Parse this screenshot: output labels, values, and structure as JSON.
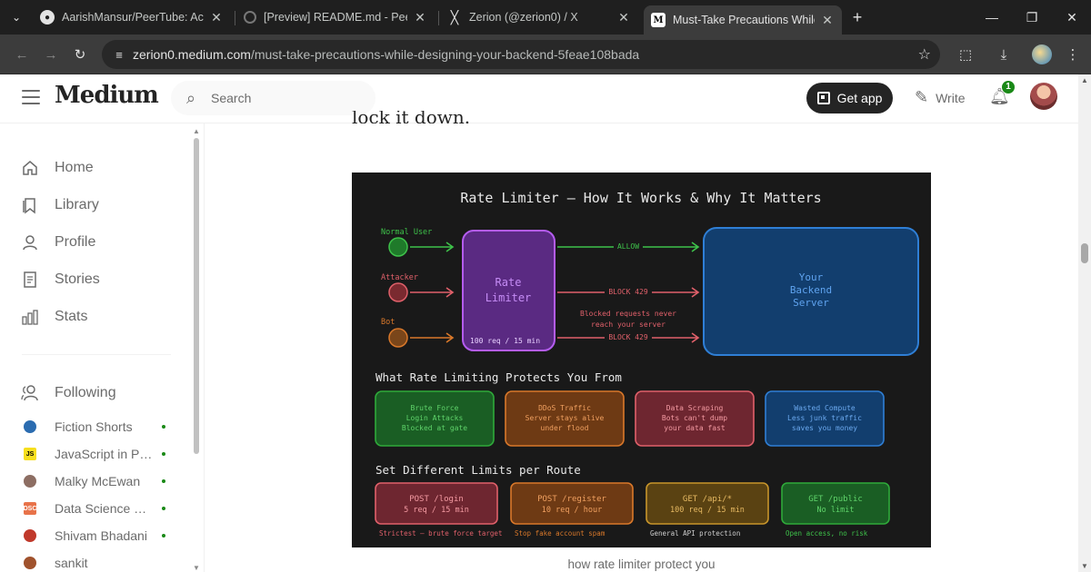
{
  "browser": {
    "tabs": [
      {
        "title": "AarishMansur/PeerTube: Activit",
        "icon": "github-icon"
      },
      {
        "title": "[Preview] README.md - PeerTu",
        "icon": "loading-icon"
      },
      {
        "title": "Zerion (@zerion0) / X",
        "icon": "x-logo-icon"
      },
      {
        "title": "Must-Take Precautions While De",
        "icon": "medium-icon",
        "active": true
      }
    ],
    "url_host": "zerion0.medium.com",
    "url_path": "/must-take-precautions-while-designing-your-backend-5feae108bada"
  },
  "header": {
    "logo": "Medium",
    "search_placeholder": "Search",
    "get_app": "Get app",
    "write": "Write",
    "notification_count": "1"
  },
  "sidebar": {
    "nav": [
      {
        "label": "Home",
        "icon": "home-icon"
      },
      {
        "label": "Library",
        "icon": "bookmark-icon"
      },
      {
        "label": "Profile",
        "icon": "person-icon"
      },
      {
        "label": "Stories",
        "icon": "document-icon"
      },
      {
        "label": "Stats",
        "icon": "bar-chart-icon"
      }
    ],
    "following_label": "Following",
    "following": [
      {
        "label": "Fiction Shorts",
        "color": "#2b6cb0",
        "mark": ""
      },
      {
        "label": "JavaScript in Pla…",
        "color": "#f7df1e",
        "mark": "JS"
      },
      {
        "label": "Malky McEwan",
        "color": "#8d6e63",
        "mark": ""
      },
      {
        "label": "Data Science Co…",
        "color": "#e8734a",
        "mark": "DSC"
      },
      {
        "label": "Shivam Bhadani",
        "color": "#c0392b",
        "mark": ""
      },
      {
        "label": "sankit",
        "color": "#a0522d",
        "mark": ""
      }
    ]
  },
  "article": {
    "cutoff_text": "lock it down.",
    "caption": "how rate limiter protect you"
  },
  "diagram": {
    "title": "Rate Limiter — How It Works & Why It Matters",
    "clients": [
      "Normal User",
      "Attacker",
      "Bot"
    ],
    "limiter_line1": "Rate",
    "limiter_line2": "Limiter",
    "limiter_note": "100 req / 15 min",
    "allow": "ALLOW",
    "block1": "BLOCK 429",
    "block2": "BLOCK 429",
    "blocked_note_1": "Blocked requests never",
    "blocked_note_2": "reach your server",
    "server_1": "Your",
    "server_2": "Backend",
    "server_3": "Server",
    "protects_heading": "What Rate Limiting Protects You From",
    "protects": [
      {
        "l1": "Brute Force",
        "l2": "Login Attacks",
        "l3": "Blocked at gate",
        "color": "#2faa3a"
      },
      {
        "l1": "DDoS Traffic",
        "l2": "Server stays alive",
        "l3": "under flood",
        "color": "#d9782a"
      },
      {
        "l1": "Data Scraping",
        "l2": "Bots can't dump",
        "l3": "your data fast",
        "color": "#e0606a"
      },
      {
        "l1": "Wasted Compute",
        "l2": "Less junk traffic",
        "l3": "saves you money",
        "color": "#2f7fd6"
      }
    ],
    "limits_heading": "Set Different Limits per Route",
    "limits": [
      {
        "route": "POST /login",
        "limit": "5 req / 15 min",
        "note": "Strictest — brute force target",
        "color": "#e0606a"
      },
      {
        "route": "POST /register",
        "limit": "10 req / hour",
        "note": "Stop fake account spam",
        "color": "#d9782a"
      },
      {
        "route": "GET /api/*",
        "limit": "100 req / 15 min",
        "note": "General API protection",
        "color": "#c7952b"
      },
      {
        "route": "GET /public",
        "limit": "No limit",
        "note": "Open access, no risk",
        "color": "#2faa3a"
      }
    ]
  }
}
